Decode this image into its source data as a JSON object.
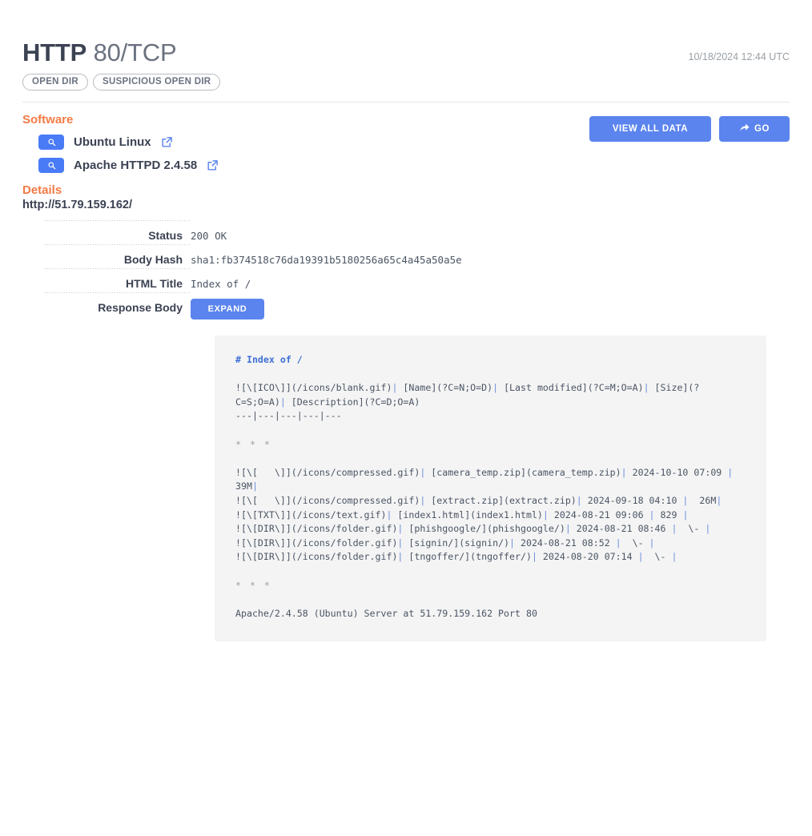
{
  "header": {
    "protocol": "HTTP",
    "port": "80/TCP",
    "timestamp": "10/18/2024 12:44 UTC",
    "chips": [
      "OPEN DIR",
      "SUSPICIOUS OPEN DIR"
    ]
  },
  "actions": {
    "view_all_data": "VIEW ALL DATA",
    "go": "GO",
    "go_icon": "share-arrow-icon"
  },
  "software": {
    "heading": "Software",
    "items": [
      {
        "name": "Ubuntu Linux",
        "search_icon": "search-icon",
        "link_icon": "external-link-icon"
      },
      {
        "name": "Apache HTTPD 2.4.58",
        "search_icon": "search-icon",
        "link_icon": "external-link-icon"
      }
    ]
  },
  "details": {
    "heading": "Details",
    "url": "http://51.79.159.162/",
    "rows": [
      {
        "key": "Status",
        "value": "200 OK"
      },
      {
        "key": "Body Hash",
        "value": "sha1:fb374518c76da19391b5180256a65c4a45a50a5e"
      },
      {
        "key": "HTML Title",
        "value": "Index of /"
      },
      {
        "key": "Response Body",
        "value": ""
      }
    ],
    "expand_label": "EXPAND"
  },
  "response_body": {
    "heading_line": "# Index of /",
    "table_header_line": "![\\[ICO\\]](/icons/blank.gif)| [Name](?C=N;O=D)| [Last modified](?C=M;O=A)| [Size](?C=S;O=A)| [Description](?C=D;O=A)",
    "table_sep_line": "---|---|---|---|---",
    "rule_top": "* * *",
    "entries": [
      "![\\[   \\]](/icons/compressed.gif)| [camera_temp.zip](camera_temp.zip)| 2024-10-10 07:09 |  39M|",
      "![\\[   \\]](/icons/compressed.gif)| [extract.zip](extract.zip)| 2024-09-18 04:10 |  26M|",
      "![\\[TXT\\]](/icons/text.gif)| [index1.html](index1.html)| 2024-08-21 09:06 | 829 |",
      "![\\[DIR\\]](/icons/folder.gif)| [phishgoogle/](phishgoogle/)| 2024-08-21 08:46 |  \\- |",
      "![\\[DIR\\]](/icons/folder.gif)| [signin/](signin/)| 2024-08-21 08:52 |  \\- |",
      "![\\[DIR\\]](/icons/folder.gif)| [tngoffer/](tngoffer/)| 2024-08-20 07:14 |  \\- |"
    ],
    "rule_bottom": "* * *",
    "footer": "Apache/2.4.58 (Ubuntu) Server at 51.79.159.162 Port 80"
  },
  "colors": {
    "accent_orange": "#f47b45",
    "primary_blue": "#5b84ee",
    "text_dark": "#3b4252",
    "code_bg": "#f4f4f5"
  }
}
